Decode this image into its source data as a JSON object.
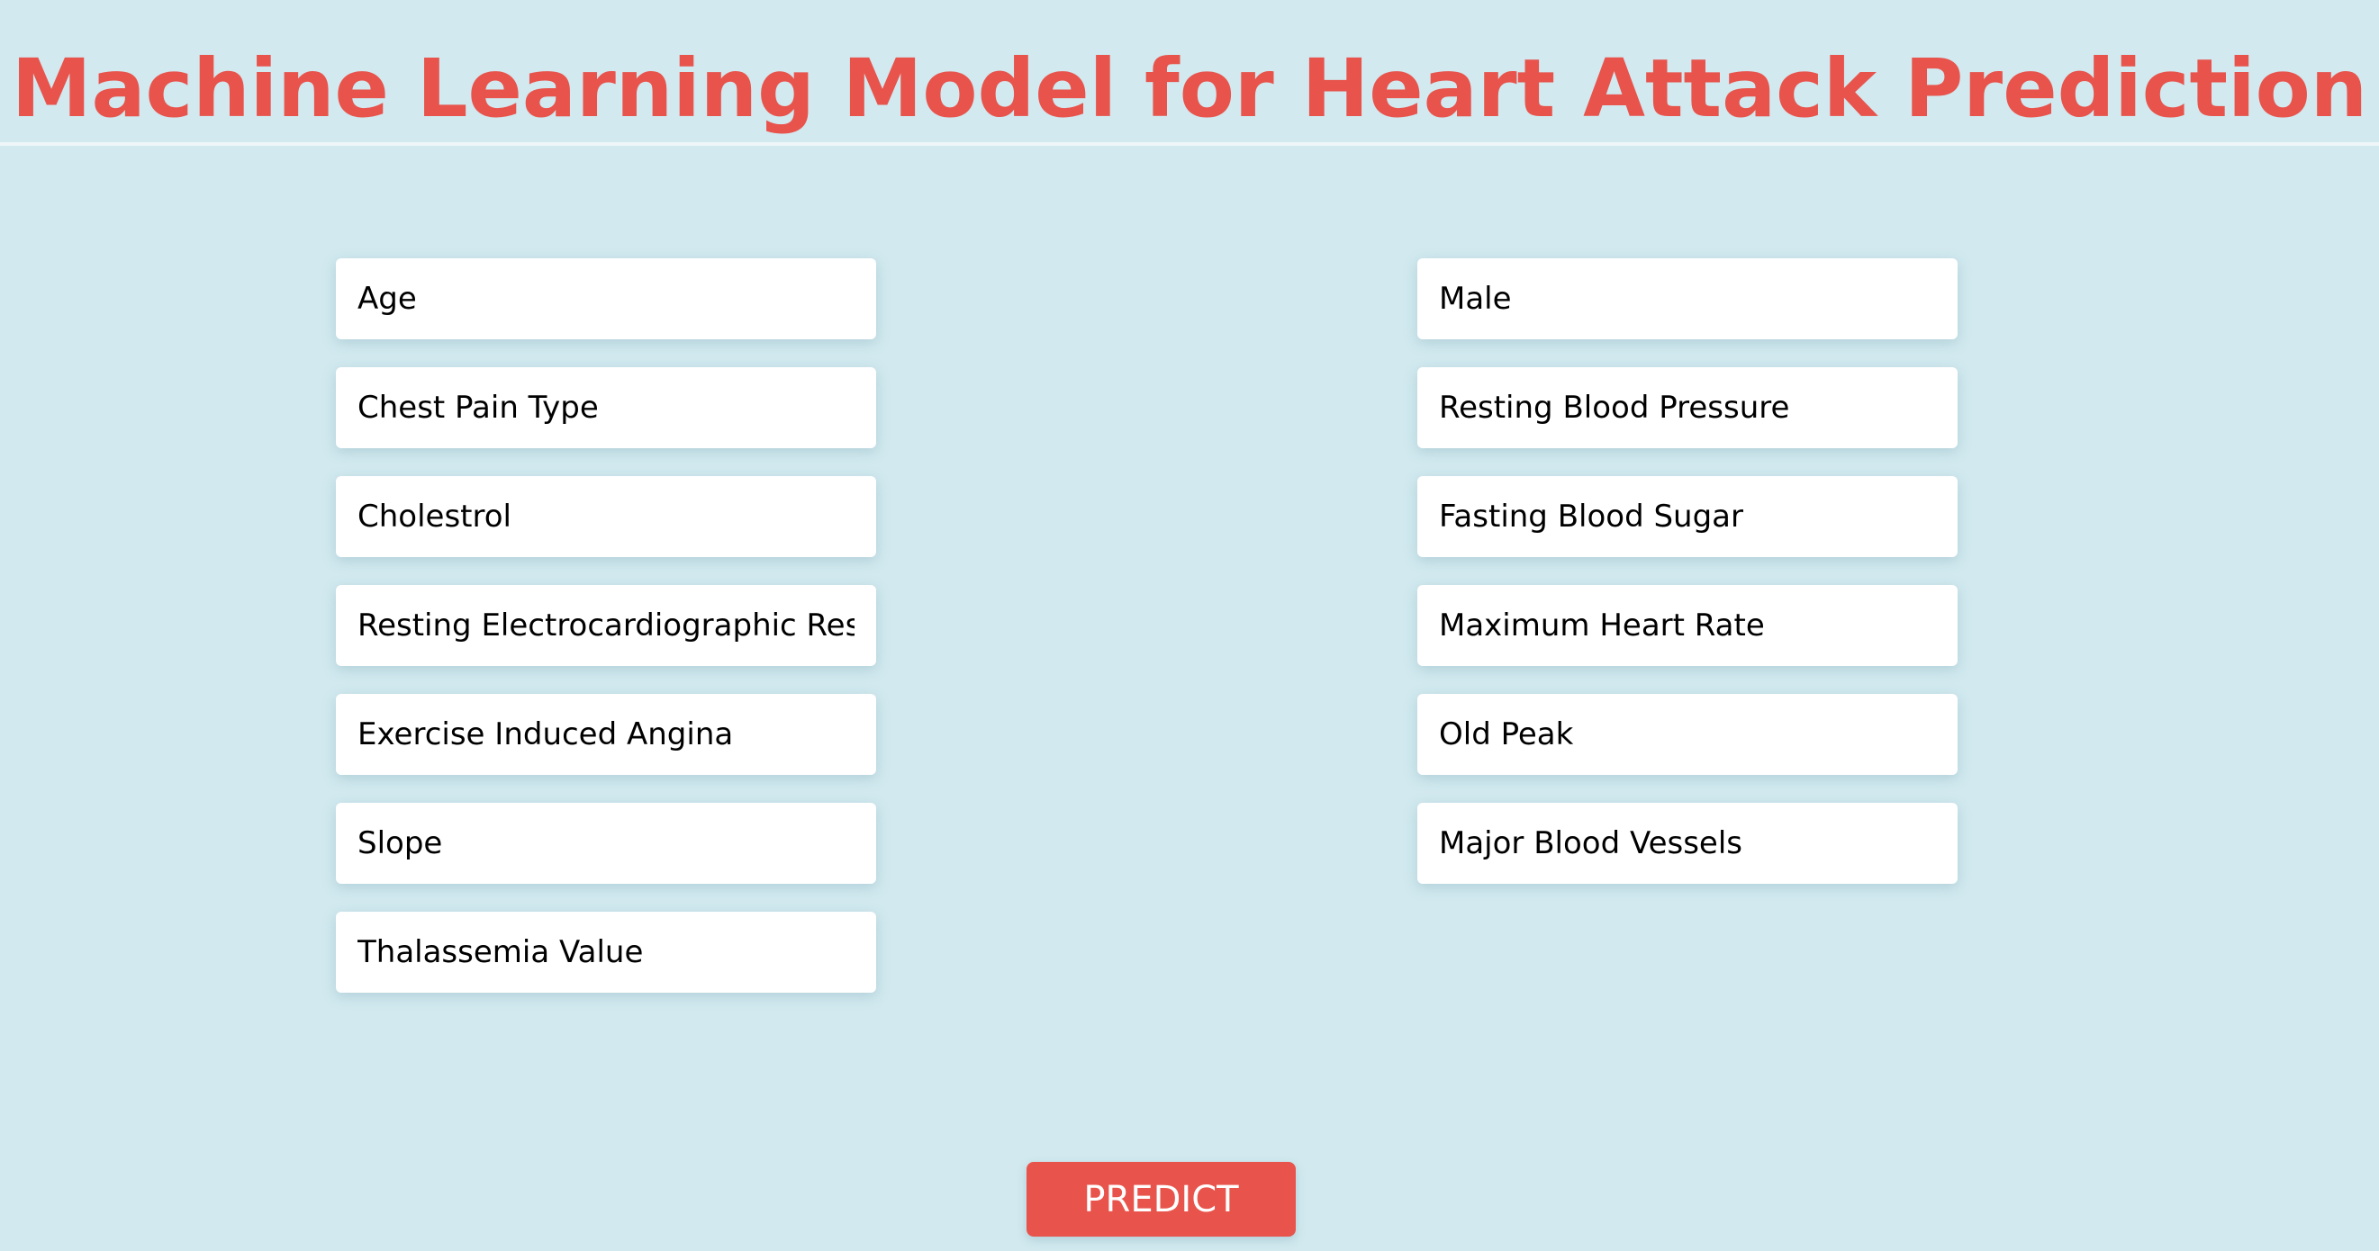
{
  "header": {
    "title": "Machine Learning Model for Heart Attack Prediction"
  },
  "form": {
    "left_fields": [
      {
        "placeholder": "Age",
        "value": ""
      },
      {
        "placeholder": "Chest Pain Type",
        "value": ""
      },
      {
        "placeholder": "Cholestrol",
        "value": ""
      },
      {
        "placeholder": "Resting Electrocardiographic Results",
        "value": ""
      },
      {
        "placeholder": "Exercise Induced Angina",
        "value": ""
      },
      {
        "placeholder": "Slope",
        "value": ""
      },
      {
        "placeholder": "Thalassemia Value",
        "value": ""
      }
    ],
    "right_fields": [
      {
        "placeholder": "Male",
        "value": ""
      },
      {
        "placeholder": "Resting Blood Pressure",
        "value": ""
      },
      {
        "placeholder": "Fasting Blood Sugar",
        "value": ""
      },
      {
        "placeholder": "Maximum Heart Rate",
        "value": ""
      },
      {
        "placeholder": "Old Peak",
        "value": ""
      },
      {
        "placeholder": "Major Blood Vessels",
        "value": ""
      }
    ],
    "submit_label": "PREDICT"
  },
  "colors": {
    "background": "#d1e9ef",
    "accent": "#e8534c",
    "field_background": "#ffffff"
  }
}
